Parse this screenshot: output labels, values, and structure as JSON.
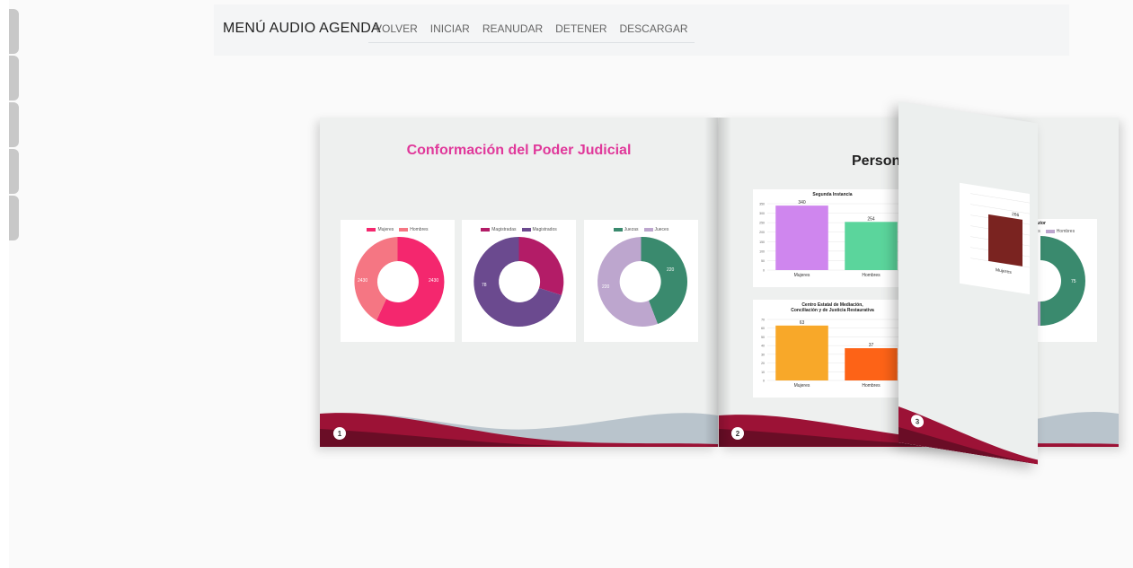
{
  "menu": {
    "title": "MENÚ AUDIO AGENDA",
    "items": [
      "VOLVER",
      "INICIAR",
      "REANUDAR",
      "DETENER",
      "DESCARGAR"
    ]
  },
  "page1": {
    "title": "Conformación del Poder Judicial",
    "number": "1",
    "donuts": [
      {
        "legend": [
          "Mujeres",
          "Hombres"
        ],
        "colors": [
          "#f4276e",
          "#f57683"
        ],
        "labels": [
          "2430",
          "2430"
        ],
        "values": [
          0.56,
          0.44
        ]
      },
      {
        "legend": [
          "Magistradas",
          "Magistrados"
        ],
        "colors": [
          "#b31c67",
          "#6b4a8f"
        ],
        "labels": [
          "",
          "78"
        ],
        "values": [
          0.3,
          0.7
        ]
      },
      {
        "legend": [
          "Juezas",
          "Jueces"
        ],
        "colors": [
          "#3a8a6e",
          "#bda6ce"
        ],
        "labels": [
          "220",
          "220"
        ],
        "values": [
          0.44,
          0.56
        ]
      }
    ]
  },
  "page2": {
    "title": "Personal Adsc",
    "number": "2",
    "charts": [
      {
        "title": "Segunda Instancia",
        "categories": [
          "Mujeres",
          "Hombres"
        ],
        "values": [
          340,
          254
        ],
        "colors": [
          "#cf86ee",
          "#5bd59c"
        ],
        "ymax": 350,
        "ticks": [
          "0",
          "50",
          "100",
          "150",
          "200",
          "250",
          "300",
          "350"
        ]
      },
      {
        "title": "Centro Estatal de Mediación, Conciliación y de Justicia Restaurativa",
        "title_lines": [
          "Centro Estatal de Mediación,",
          "Conciliación y de Justicia Restaurativa"
        ],
        "categories": [
          "Mujeres",
          "Hombres"
        ],
        "values": [
          63,
          37
        ],
        "colors": [
          "#f8a829",
          "#fd6317"
        ],
        "ymax": 70,
        "ticks": [
          "0",
          "10",
          "20",
          "30",
          "40",
          "50",
          "60",
          "70"
        ]
      }
    ],
    "partial_donut": {
      "title": "Ejecutor",
      "legend": [
        "Mujeres",
        "Hombres"
      ],
      "colors": [
        "#3a8a6e",
        "#bda6ce"
      ],
      "label": "75"
    }
  },
  "page3": {
    "number": "3",
    "bar": {
      "categories": [
        "Mujeres"
      ],
      "values": [
        266
      ],
      "color": "#7a2320",
      "label": "266"
    }
  },
  "chart_data": [
    {
      "type": "pie",
      "categories": [
        "Mujeres",
        "Hombres"
      ],
      "values": [
        56,
        44
      ]
    },
    {
      "type": "pie",
      "categories": [
        "Magistradas",
        "Magistrados"
      ],
      "values": [
        30,
        70
      ]
    },
    {
      "type": "pie",
      "categories": [
        "Juezas",
        "Jueces"
      ],
      "values": [
        44,
        56
      ]
    },
    {
      "type": "bar",
      "title": "Segunda Instancia",
      "categories": [
        "Mujeres",
        "Hombres"
      ],
      "values": [
        340,
        254
      ],
      "ylim": [
        0,
        350
      ]
    },
    {
      "type": "bar",
      "title": "Centro Estatal de Mediación, Conciliación y de Justicia Restaurativa",
      "categories": [
        "Mujeres",
        "Hombres"
      ],
      "values": [
        63,
        37
      ],
      "ylim": [
        0,
        70
      ]
    }
  ]
}
